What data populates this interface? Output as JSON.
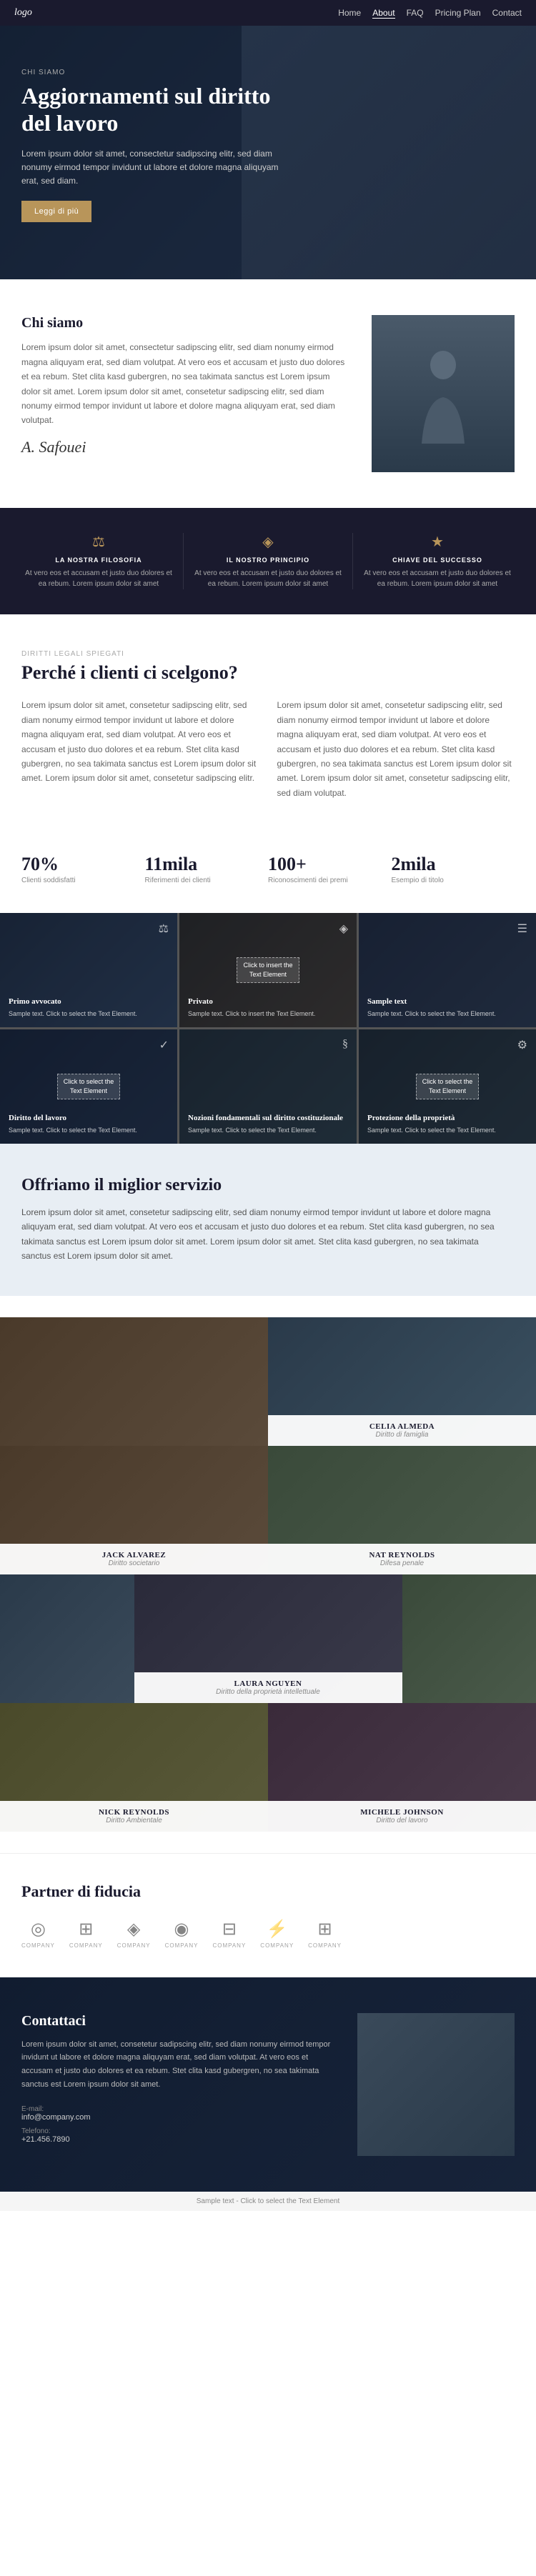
{
  "nav": {
    "logo": "logo",
    "links": [
      "Home",
      "About",
      "FAQ",
      "Pricing Plan",
      "Contact"
    ],
    "active": "About"
  },
  "hero": {
    "tag": "CHI SIAMO",
    "title": "Aggiornamenti sul diritto del lavoro",
    "description": "Lorem ipsum dolor sit amet, consectetur sadipscing elitr, sed diam nonumy eirmod tempor invidunt ut labore et dolore magna aliquyam erat, sed diam.",
    "cta": "Leggi di più"
  },
  "chi_siamo": {
    "title": "Chi siamo",
    "text": "Lorem ipsum dolor sit amet, consectetur sadipscing elitr, sed diam nonumy eirmod magna aliquyam erat, sed diam volutpat. At vero eos et accusam et justo duo dolores et ea rebum. Stet clita kasd gubergren, no sea takimata sanctus est Lorem ipsum dolor sit amet. Lorem ipsum dolor sit amet, consetetur sadipscing elitr, sed diam nonumy eirmod tempor invidunt ut labore et dolore magna aliquyam erat, sed diam volutpat.",
    "signature": "A. Safouei"
  },
  "filosofia": [
    {
      "icon": "⚖",
      "title": "LA NOSTRA FILOSOFIA",
      "text": "At vero eos et accusam et justo duo dolores et ea rebum. Lorem ipsum dolor sit amet"
    },
    {
      "icon": "◈",
      "title": "IL NOSTRO PRINCIPIO",
      "text": "At vero eos et accusam et justo duo dolores et ea rebum. Lorem ipsum dolor sit amet"
    },
    {
      "icon": "★",
      "title": "CHIAVE DEL SUCCESSO",
      "text": "At vero eos et accusam et justo duo dolores et ea rebum. Lorem ipsum dolor sit amet"
    }
  ],
  "perche": {
    "tag": "DIRITTI LEGALI SPIEGATI",
    "title": "Perché i clienti ci scelgono?",
    "col1": "Lorem ipsum dolor sit amet, consetetur sadipscing elitr, sed diam nonumy eirmod tempor invidunt ut labore et dolore magna aliquyam erat, sed diam volutpat. At vero eos et accusam et justo duo dolores et ea rebum. Stet clita kasd gubergren, no sea takimata sanctus est Lorem ipsum dolor sit amet. Lorem ipsum dolor sit amet, consetetur sadipscing elitr.",
    "col2": "Lorem ipsum dolor sit amet, consetetur sadipscing elitr, sed diam nonumy eirmod tempor invidunt ut labore et dolore magna aliquyam erat, sed diam volutpat. At vero eos et accusam et justo duo dolores et ea rebum. Stet clita kasd gubergren, no sea takimata sanctus est Lorem ipsum dolor sit amet. Lorem ipsum dolor sit amet, consetetur sadipscing elitr, sed diam volutpat."
  },
  "stats": [
    {
      "number": "70%",
      "label": "Clienti soddisfatti"
    },
    {
      "number": "11mila",
      "label": "Riferimenti dei clienti"
    },
    {
      "number": "100+",
      "label": "Riconoscimenti dei premi"
    },
    {
      "number": "2mila",
      "label": "Esempio di titolo"
    }
  ],
  "services": [
    {
      "title": "Primo avvocato",
      "desc": "Sample text. Click to select the Text Element.",
      "icon": "⚖"
    },
    {
      "title": "Privato",
      "desc": "Sample text. Click to insert the Text Element.",
      "icon": "◈",
      "has_select_overlay": true,
      "select_text": "Click to insert the Text Element"
    },
    {
      "title": "Sample text",
      "desc": "Sample text. Click to select the Text Element.",
      "icon": "☰"
    },
    {
      "title": "Diritto del lavoro",
      "desc": "Sample text. Click to select the Text Element.",
      "icon": "✓",
      "has_select_overlay": true,
      "select_text": "Click to select the Text Element"
    },
    {
      "title": "Nozioni fondamentali sul diritto costituzionale",
      "desc": "Sample text. Click to select the Text Element.",
      "icon": "§"
    },
    {
      "title": "Protezione della proprietà",
      "desc": "Sample text. Click to select the Text Element.",
      "icon": "⚙",
      "has_select_overlay": true,
      "select_text": "Click to select the Text Element"
    }
  ],
  "migliore": {
    "title": "Offriamo il miglior servizio",
    "text": "Lorem ipsum dolor sit amet, consetetur sadipscing elitr, sed diam nonumy eirmod tempor invidunt ut labore et dolore magna aliquyam erat, sed diam volutpat. At vero eos et accusam et justo duo dolores et ea rebum. Stet clita kasd gubergren, no sea takimata sanctus est Lorem ipsum dolor sit amet. Lorem ipsum dolor sit amet. Stet clita kasd gubergren, no sea takimata sanctus est Lorem ipsum dolor sit amet."
  },
  "team": [
    {
      "name": "CELIA ALMEDA",
      "role": "Diritto di famiglia",
      "bg_class": "tc-1",
      "position": "top-right"
    },
    {
      "name": "JACK ALVAREZ",
      "role": "Diritto societario",
      "bg_class": "tc-2",
      "position": "left"
    },
    {
      "name": "NAT REYNOLDS",
      "role": "Difesa penale",
      "bg_class": "tc-3",
      "position": "right"
    },
    {
      "name": "LAURA NGUYEN",
      "role": "Diritto della proprietà intellettuale",
      "bg_class": "tc-4",
      "position": "center"
    },
    {
      "name": "NICK REYNOLDS",
      "role": "Diritto Ambientale",
      "bg_class": "tc-5",
      "position": "bottom-left"
    },
    {
      "name": "MICHELE JOHNSON",
      "role": "Diritto del lavoro",
      "bg_class": "tc-6",
      "position": "bottom-right"
    }
  ],
  "partners": {
    "title": "Partner di fiducia",
    "logos": [
      {
        "icon": "◎",
        "name": "COMPANY"
      },
      {
        "icon": "⊞",
        "name": "COMPANY"
      },
      {
        "icon": "◈",
        "name": "COMPANY"
      },
      {
        "icon": "◉",
        "name": "COMPANY"
      },
      {
        "icon": "⊟",
        "name": "COMPANY"
      },
      {
        "icon": "⚡",
        "name": "COMPANY"
      },
      {
        "icon": "⊞",
        "name": "COMPANY"
      }
    ]
  },
  "contattaci": {
    "title": "Contattaci",
    "text": "Lorem ipsum dolor sit amet, consetetur sadipscing elitr, sed diam nonumy eirmod tempor invidunt ut labore et dolore magna aliquyam erat, sed diam volutpat. At vero eos et accusam et justo duo dolores et ea rebum. Stet clita kasd gubergren, no sea takimata sanctus est Lorem ipsum dolor sit amet.",
    "email_label": "E-mail:",
    "email_value": "info@company.com",
    "phone_label": "Telefono:",
    "phone_value": "+21.456.7890"
  },
  "sample_label": "Sample text - Click to select the Text Element"
}
